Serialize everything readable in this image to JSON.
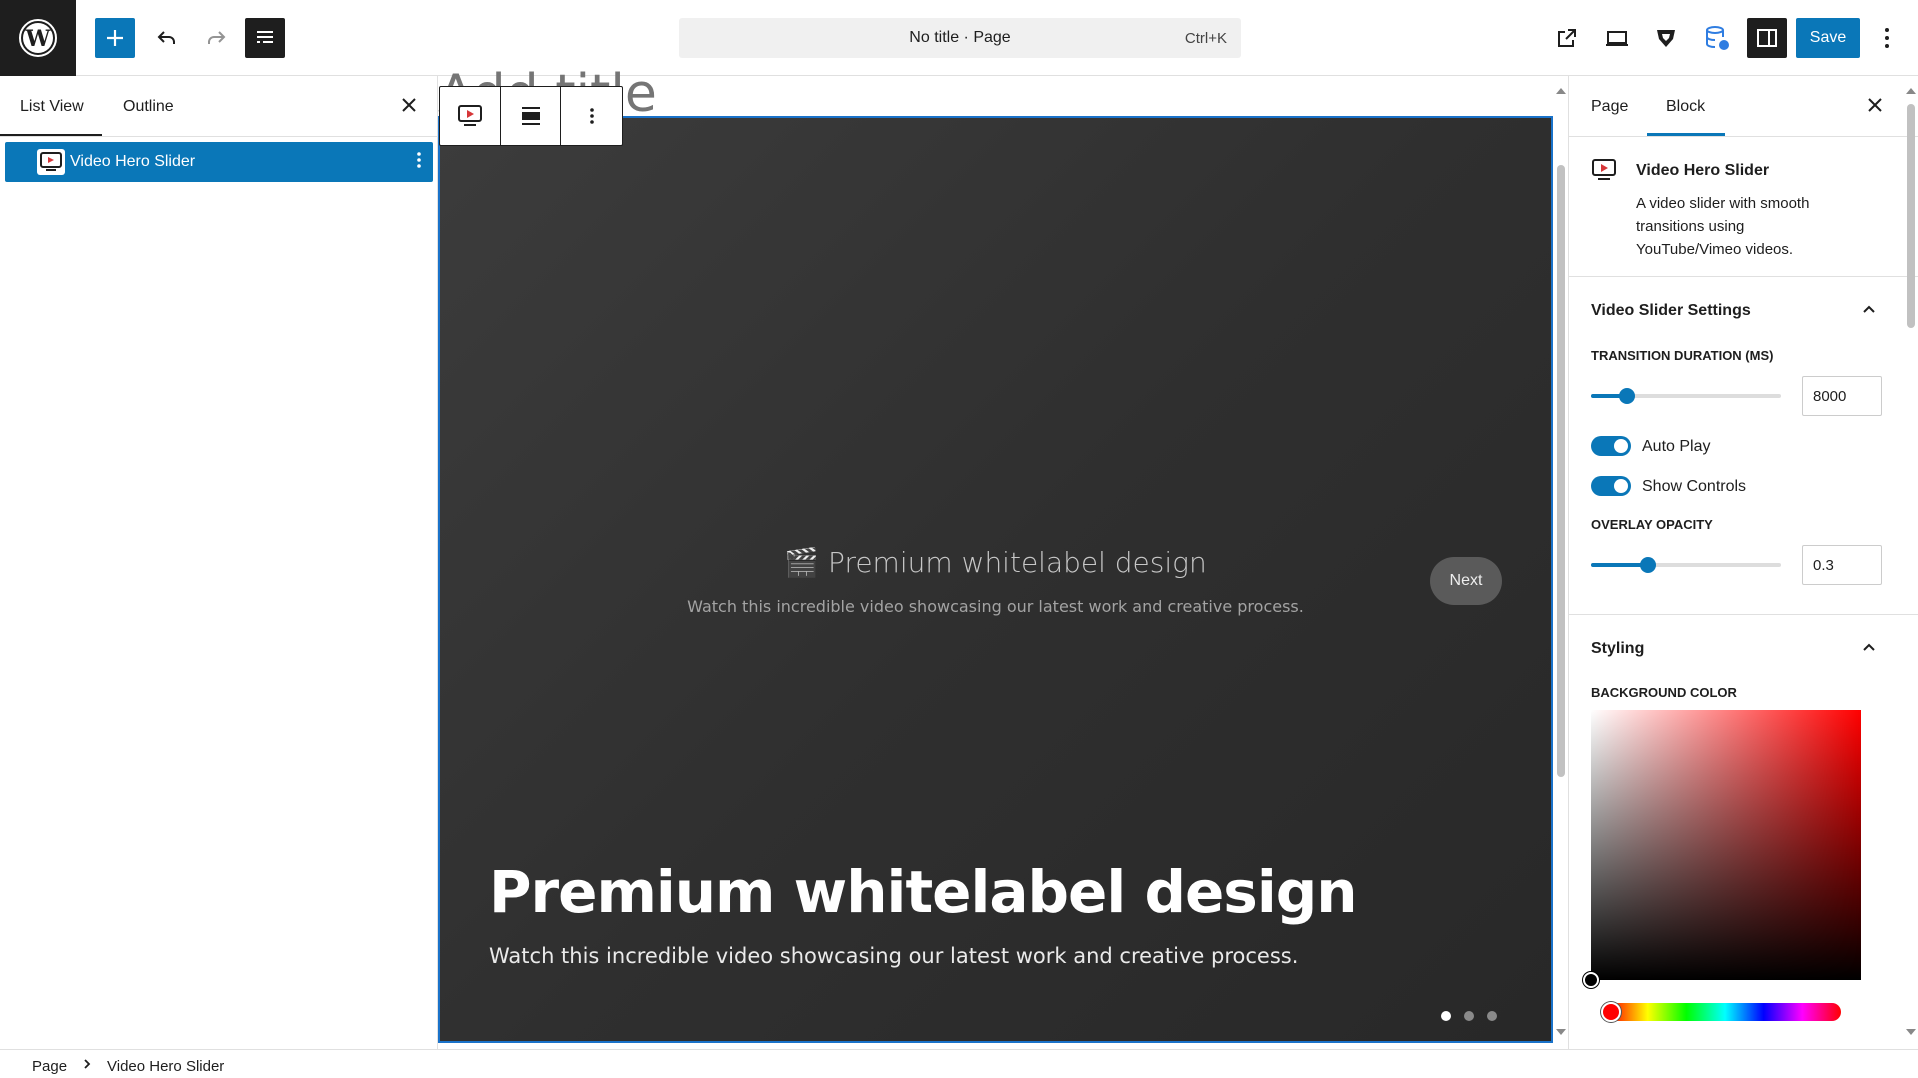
{
  "topbar": {
    "document_title": "No title · Page",
    "shortcut": "Ctrl+K",
    "save_label": "Save"
  },
  "list_panel": {
    "tabs": [
      "List View",
      "Outline"
    ],
    "active_tab": "List View",
    "items": [
      {
        "label": "Video Hero Slider",
        "selected": true
      }
    ]
  },
  "canvas": {
    "title_placeholder": "Add title",
    "hero": {
      "center_title": "🎬 Premium whitelabel design",
      "center_subtitle": "Watch this incredible video showcasing our latest work and creative process.",
      "next_label": "Next",
      "main_title": "Premium whitelabel design",
      "main_subtitle": "Watch this incredible video showcasing our latest work and creative process.",
      "slides_count": 3,
      "active_slide": 1
    }
  },
  "settings_sidebar": {
    "tabs": [
      "Page",
      "Block"
    ],
    "active_tab": "Block",
    "block_card": {
      "title": "Video Hero Slider",
      "description": "A video slider with smooth transitions using YouTube/Vimeo videos."
    },
    "slider_settings": {
      "title": "Video Slider Settings",
      "transition_label": "TRANSITION DURATION (MS)",
      "transition_value": "8000",
      "transition_fraction": 0.19,
      "autoplay_label": "Auto Play",
      "autoplay_on": true,
      "controls_label": "Show Controls",
      "controls_on": true,
      "overlay_label": "OVERLAY OPACITY",
      "overlay_value": "0.3",
      "overlay_fraction": 0.3
    },
    "styling": {
      "title": "Styling",
      "bg_color_label": "BACKGROUND COLOR"
    }
  },
  "breadcrumb": [
    "Page",
    "Video Hero Slider"
  ],
  "colors": {
    "accent": "#0a77b8",
    "dark": "#1e1e1e",
    "hero_bg": "#333333"
  }
}
